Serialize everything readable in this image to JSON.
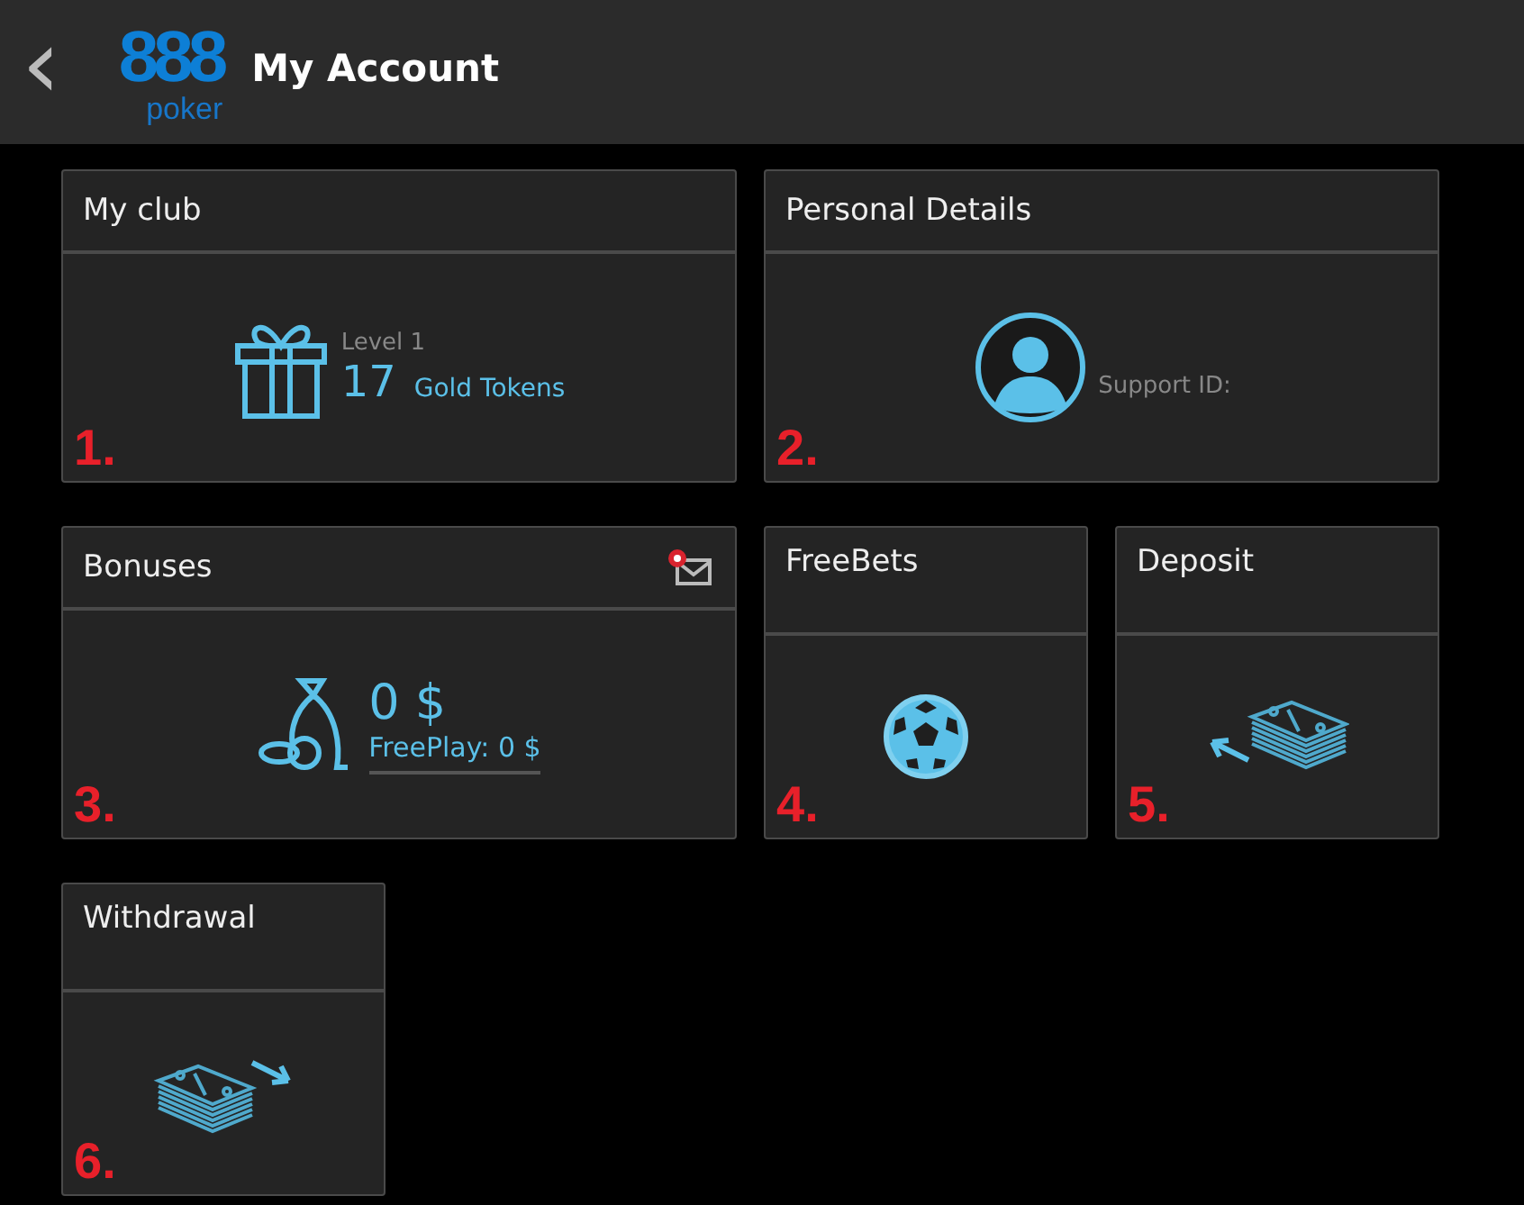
{
  "header": {
    "back": "‹",
    "logo": {
      "digits": "888",
      "word": "poker"
    },
    "title": "My Account"
  },
  "cards": [
    {
      "kind": "club",
      "title": "My club",
      "marker": "1.",
      "level": "Level 1",
      "tokens": "17",
      "tokens_label": "Gold Tokens"
    },
    {
      "kind": "personal",
      "title": "Personal Details",
      "marker": "2.",
      "support": "Support ID:"
    },
    {
      "kind": "bonuses",
      "title": "Bonuses",
      "marker": "3.",
      "mail_alert": true,
      "amount": "0 $",
      "freeplay": "FreePlay: 0 $"
    },
    {
      "kind": "freebets",
      "title": "FreeBets",
      "marker": "4."
    },
    {
      "kind": "deposit",
      "title": "Deposit",
      "marker": "5."
    },
    {
      "kind": "withdrawal",
      "title": "Withdrawal",
      "marker": "6."
    }
  ]
}
